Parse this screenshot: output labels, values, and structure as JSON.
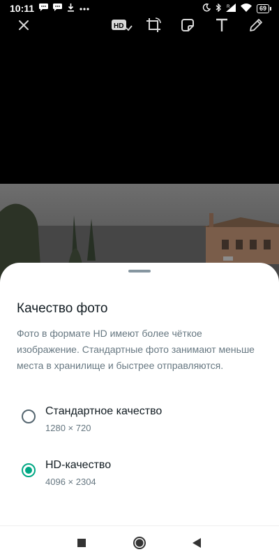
{
  "status_bar": {
    "time": "10:11",
    "battery": "69",
    "left_icons": [
      "message-icon",
      "message-icon",
      "download-icon",
      "more-dots-icon"
    ],
    "right_icons": [
      "moon-icon",
      "bluetooth-icon",
      "signal-icon",
      "wifi-icon",
      "battery-icon"
    ]
  },
  "editor_toolbar": {
    "close_icon": "close-icon",
    "hd_label": "HD",
    "tools": [
      "hd-quality-icon",
      "crop-rotate-icon",
      "sticker-icon",
      "text-icon",
      "pencil-icon"
    ]
  },
  "quality_sheet": {
    "title": "Качество фото",
    "description": "Фото в формате HD имеют более чёткое изображение. Стандартные фото занимают меньше места в хранилище и быстрее отправляются.",
    "options": [
      {
        "label": "Стандартное качество",
        "resolution": "1280 × 720",
        "selected": false
      },
      {
        "label": "HD-качество",
        "resolution": "4096 × 2304",
        "selected": true
      }
    ],
    "accent_color": "#00a884"
  },
  "nav_bar": {
    "buttons": [
      "recents-square-icon",
      "home-circle-icon",
      "back-triangle-icon"
    ]
  }
}
